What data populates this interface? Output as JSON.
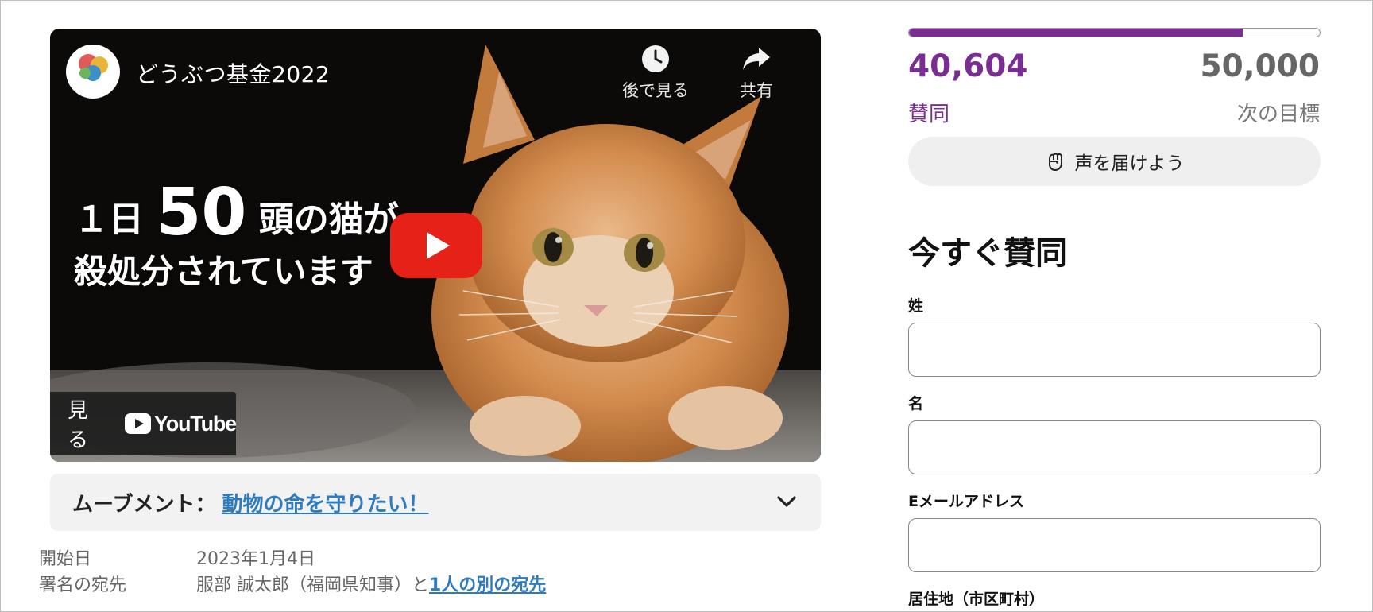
{
  "video": {
    "channel_title": "どうぶつ基金2022",
    "logo_text": "どうぶつ基金",
    "watch_later_label": "後で見る",
    "share_label": "共有",
    "overlay_line1_pre": "１日",
    "overlay_line1_num": "50",
    "overlay_line1_post": "頭の猫が",
    "overlay_line2": "殺処分されています",
    "watch_label": "見る",
    "youtube_label": "YouTube"
  },
  "movement": {
    "label": "ムーブメント：",
    "link_text": "動物の命を守りたい！"
  },
  "meta": {
    "start_label": "開始日",
    "start_value": "2023年1月4日",
    "recipient_label": "署名の宛先",
    "recipient_value": "服部 誠太郎（福岡県知事）と",
    "recipient_link": "1人の別の宛先"
  },
  "progress": {
    "current": "40,604",
    "goal": "50,000",
    "fraction": 0.812,
    "current_label": "賛同",
    "goal_label": "次の目標",
    "bar_color": "#7a2d93"
  },
  "voice_button": {
    "label": "声を届けよう",
    "icon": "fist-icon"
  },
  "form": {
    "title": "今すぐ賛同",
    "last_name_label": "姓",
    "first_name_label": "名",
    "email_label": "Eメールアドレス",
    "residence_label": "居住地（市区町村）"
  }
}
